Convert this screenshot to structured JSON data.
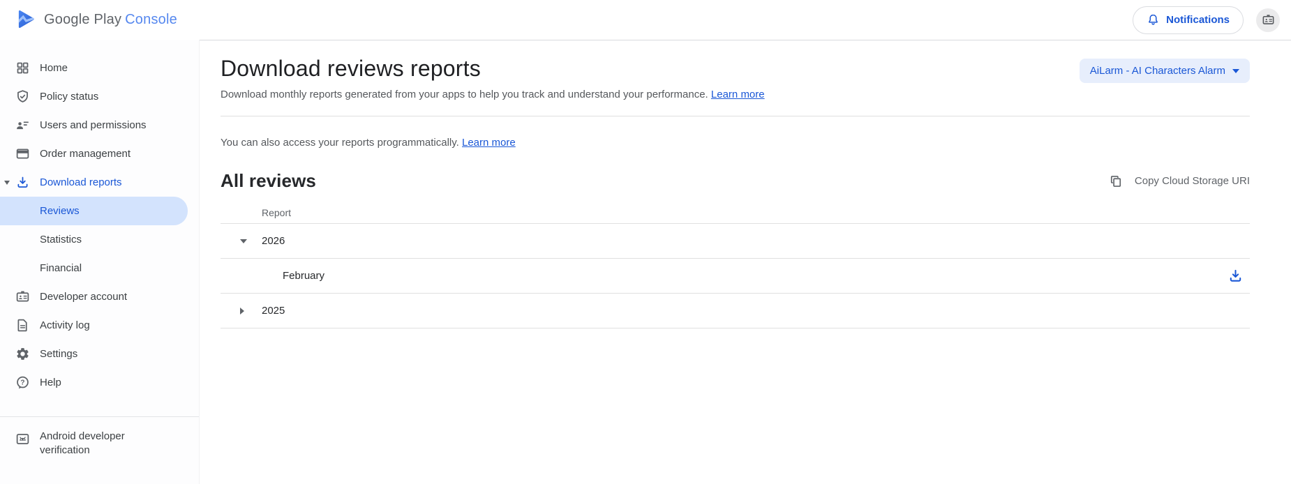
{
  "header": {
    "logo": {
      "google_play": "Google Play",
      "console": "Console"
    },
    "notifications_label": "Notifications"
  },
  "app_selector": {
    "label": "AiLarm - AI Characters Alarm"
  },
  "sidebar": {
    "items": [
      {
        "label": "Home",
        "icon": "grid-icon"
      },
      {
        "label": "Policy status",
        "icon": "shield-check-icon"
      },
      {
        "label": "Users and permissions",
        "icon": "users-icon"
      },
      {
        "label": "Order management",
        "icon": "payment-card-icon"
      },
      {
        "label": "Download reports",
        "icon": "download-icon",
        "expanded": true,
        "accent": true
      },
      {
        "label": "Reviews",
        "sub_item": true,
        "selected": true
      },
      {
        "label": "Statistics",
        "sub_item": true
      },
      {
        "label": "Financial",
        "sub_item": true
      },
      {
        "label": "Developer account",
        "icon": "badge-icon"
      },
      {
        "label": "Activity log",
        "icon": "document-icon"
      },
      {
        "label": "Settings",
        "icon": "gear-icon"
      },
      {
        "label": "Help",
        "icon": "help-icon"
      }
    ],
    "footer_item": {
      "label": "Android developer verification",
      "icon": "android-icon"
    }
  },
  "main": {
    "title": "Download reviews reports",
    "subtitle": "Download monthly reports generated from your apps to help you track and understand your performance.",
    "subtitle_link": "Learn more",
    "programmatic_text": "You can also access your reports programmatically.",
    "programmatic_link": "Learn more",
    "section_title": "All reviews",
    "copy_button_label": "Copy Cloud Storage URI",
    "table": {
      "column_header": "Report",
      "rows": [
        {
          "label": "2026",
          "level": "year",
          "expanded": true
        },
        {
          "label": "February",
          "level": "month",
          "downloadable": true
        },
        {
          "label": "2025",
          "level": "year",
          "expanded": false
        }
      ]
    }
  },
  "colors": {
    "accent_blue": "#1a57d6",
    "console_blue": "#5688ef",
    "selected_item_bg": "#d3e3fd",
    "app_chip_bg": "#e7eefc",
    "text_primary": "#202124",
    "text_secondary": "#5f6368",
    "divider": "#e0e0e0"
  }
}
